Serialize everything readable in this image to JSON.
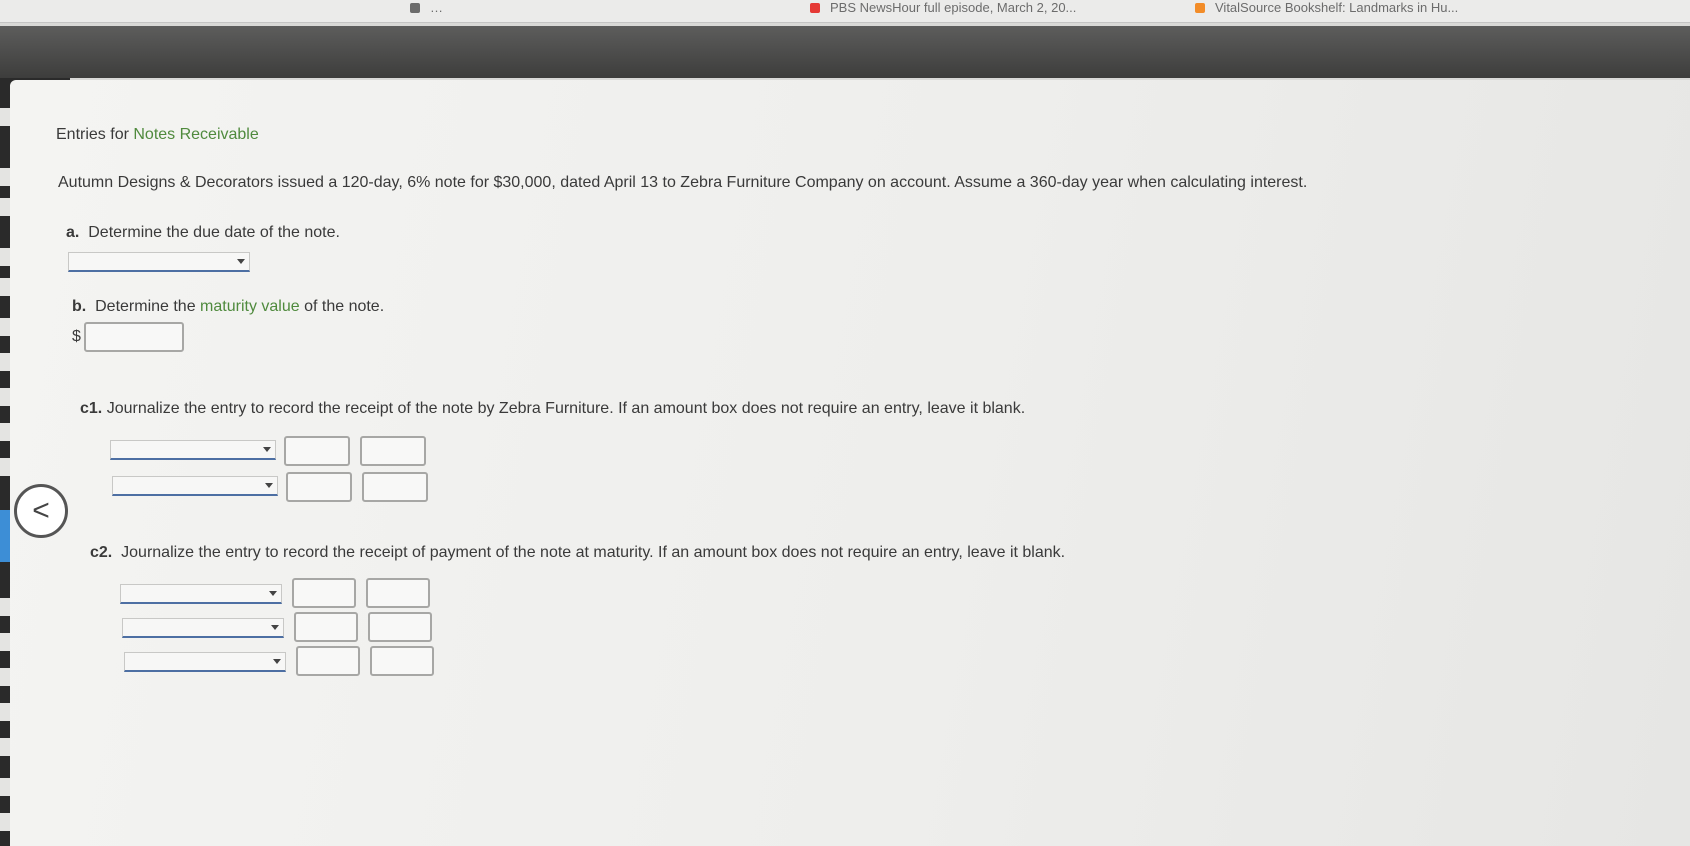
{
  "browser": {
    "tabs": [
      {
        "label": "…",
        "favicon_color": "#6b6b6b"
      },
      {
        "label": "PBS NewsHour full episode, March 2, 20...",
        "favicon_color": "#e53935"
      },
      {
        "label": "VitalSource Bookshelf: Landmarks in Hu...",
        "favicon_color": "#f28c28"
      }
    ]
  },
  "page": {
    "title_prefix": "Entries for ",
    "title_link": "Notes Receivable",
    "intro": "Autumn Designs & Decorators issued a 120-day, 6% note for $30,000, dated April 13 to Zebra Furniture Company on account. Assume a 360-day year when calculating interest.",
    "a": {
      "marker": "a.",
      "text": "Determine the due date of the note."
    },
    "b": {
      "marker": "b.",
      "text_before": "Determine the ",
      "link": "maturity value",
      "text_after": " of the note.",
      "currency": "$"
    },
    "c1": {
      "marker": "c1.",
      "text": "Journalize the entry to record the receipt of the note by Zebra Furniture. If an amount box does not require an entry, leave it blank."
    },
    "c2": {
      "marker": "c2.",
      "text": "Journalize the entry to record the receipt of payment of the note at maturity. If an amount box does not require an entry, leave it blank."
    }
  },
  "nav": {
    "back_glyph": "<"
  },
  "colors": {
    "link_green": "#4f8a3d",
    "select_underline": "#4d6fa3",
    "side_blue": "#3d8ed6"
  }
}
